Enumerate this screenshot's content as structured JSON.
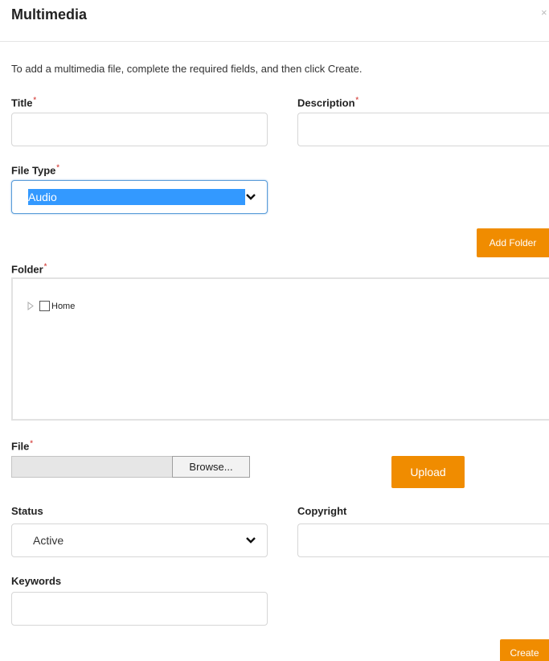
{
  "dialog": {
    "title": "Multimedia",
    "close_symbol": "×",
    "intro": "To add a multimedia file, complete the required fields, and then click Create."
  },
  "form": {
    "title": {
      "label": "Title",
      "value": "",
      "required_mark": "*"
    },
    "description": {
      "label": "Description",
      "value": "",
      "required_mark": "*"
    },
    "file_type": {
      "label": "File Type",
      "selected": "Audio",
      "required_mark": "*"
    },
    "add_folder_label": "Add Folder",
    "folder": {
      "label": "Folder",
      "required_mark": "*",
      "tree": [
        {
          "label": "Home",
          "checked": false,
          "expanded": false
        }
      ]
    },
    "file": {
      "label": "File",
      "required_mark": "*",
      "path": "",
      "browse_label": "Browse...",
      "upload_label": "Upload"
    },
    "status": {
      "label": "Status",
      "selected": "Active"
    },
    "copyright": {
      "label": "Copyright",
      "value": ""
    },
    "keywords": {
      "label": "Keywords",
      "value": ""
    },
    "create_label": "Create"
  },
  "colors": {
    "accent_orange": "#f08c00",
    "selection_blue": "#3399ff",
    "required_red": "#d9534f"
  },
  "icons": {
    "close": "close-icon",
    "dropdown": "chevron-down-icon",
    "tree_expand": "triangle-right-icon"
  }
}
